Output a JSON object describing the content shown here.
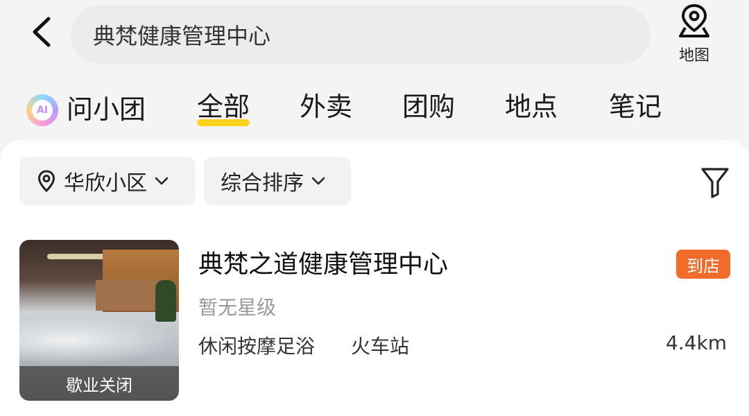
{
  "search": {
    "query": "典梵健康管理中心"
  },
  "map": {
    "label": "地图"
  },
  "tabs": {
    "ai_label": "问小团",
    "items": [
      "全部",
      "外卖",
      "团购",
      "地点",
      "笔记"
    ],
    "active": "全部"
  },
  "filters": {
    "location": "华欣小区",
    "sort": "综合排序"
  },
  "result": {
    "title": "典梵之道健康管理中心",
    "tag": "到店",
    "rating": "暂无星级",
    "category": "休闲按摩足浴",
    "area": "火车站",
    "distance": "4.4km",
    "status": "歇业关闭"
  },
  "colors": {
    "accent_underline": "#ffd21e",
    "tag_bg": "#f26b2a"
  }
}
